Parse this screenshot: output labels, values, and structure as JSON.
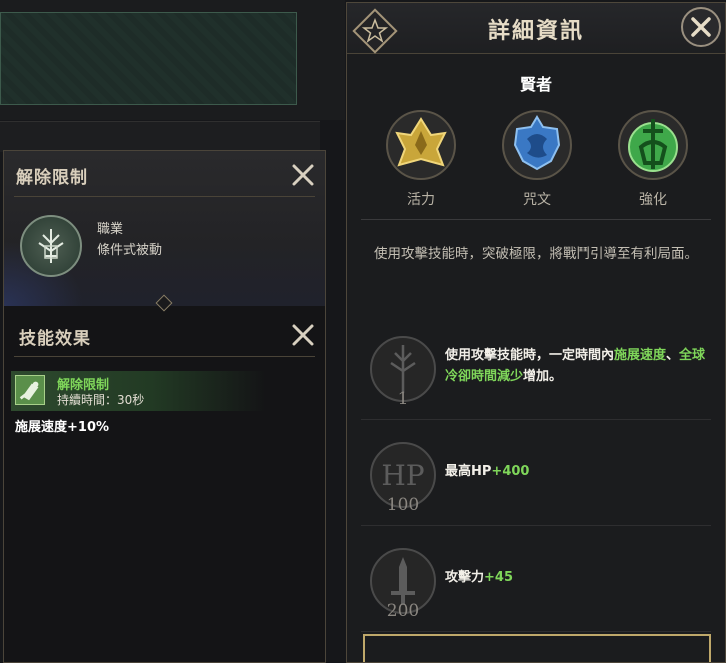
{
  "left_panel": {
    "title": "解除限制",
    "type_label": "職業",
    "type_value": "條件式被動",
    "section_title": "技能效果",
    "buff": {
      "name": "解除限制",
      "duration": "持續時間：30秒"
    },
    "effect": "施展速度+10%"
  },
  "right_panel": {
    "title": "詳細資訊",
    "class_name": "賢者",
    "attributes": [
      {
        "label": "活力",
        "color": "#c9a63a"
      },
      {
        "label": "咒文",
        "color": "#3a78c4"
      },
      {
        "label": "強化",
        "color": "#3fa84a"
      }
    ],
    "description": "使用攻擊技能時，突破極限，將戰鬥引導至有利局面。",
    "bonuses": [
      {
        "level": "1",
        "icon": "staff-icon",
        "text_pre": "使用攻擊技能時，一定時間內",
        "hl1": "施展速度",
        "text_mid": "、",
        "hl2": "全球冷卻時間減少",
        "text_post": "增加。"
      },
      {
        "level": "100",
        "icon": "hp-icon",
        "icon_text": "HP",
        "label": "最高HP",
        "value": "+400"
      },
      {
        "level": "200",
        "icon": "sword-icon",
        "label": "攻擊力",
        "value": "+45"
      }
    ]
  }
}
